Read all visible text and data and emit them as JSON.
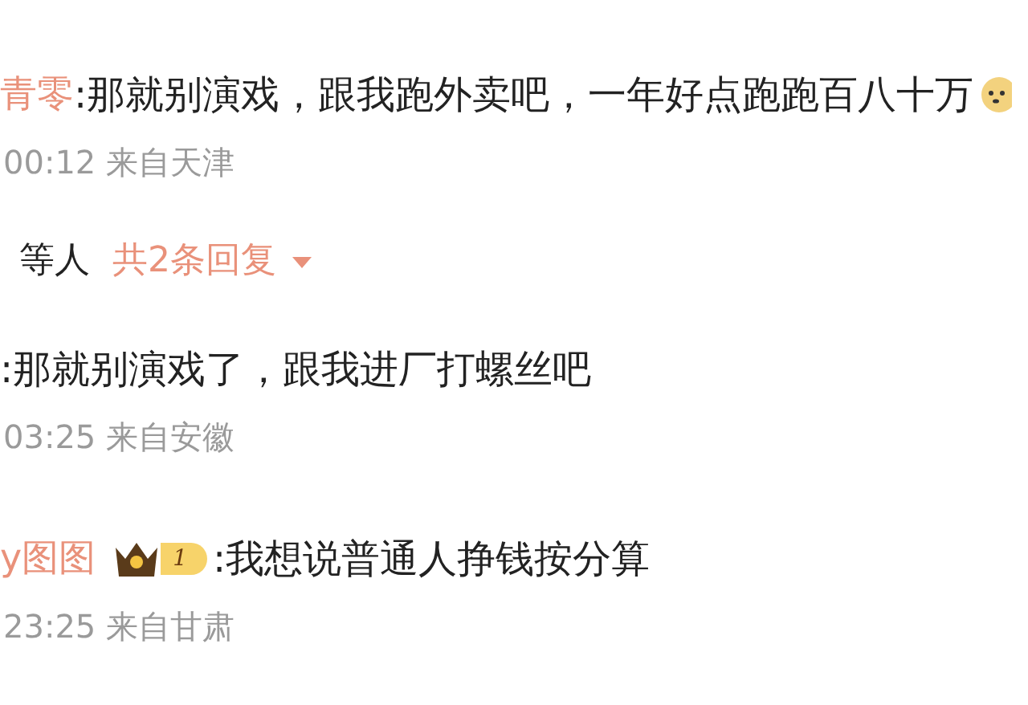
{
  "comments": [
    {
      "user": "青零",
      "text": ":那就别演戏，跟我跑外卖吧，一年好点跑跑百八十万",
      "emoji": true,
      "meta": "00:12 来自天津",
      "replies": {
        "users": "等人",
        "count": "共2条回复",
        "expanded": false
      }
    },
    {
      "text": ":那就别演戏了，跟我进厂打螺丝吧",
      "emoji": false,
      "meta": "03:25 来自安徽"
    },
    {
      "user": "y图图",
      "badge": "1",
      "text": ":我想说普通人挣钱按分算",
      "emoji": false,
      "meta": "23:25 来自甘肃"
    }
  ]
}
